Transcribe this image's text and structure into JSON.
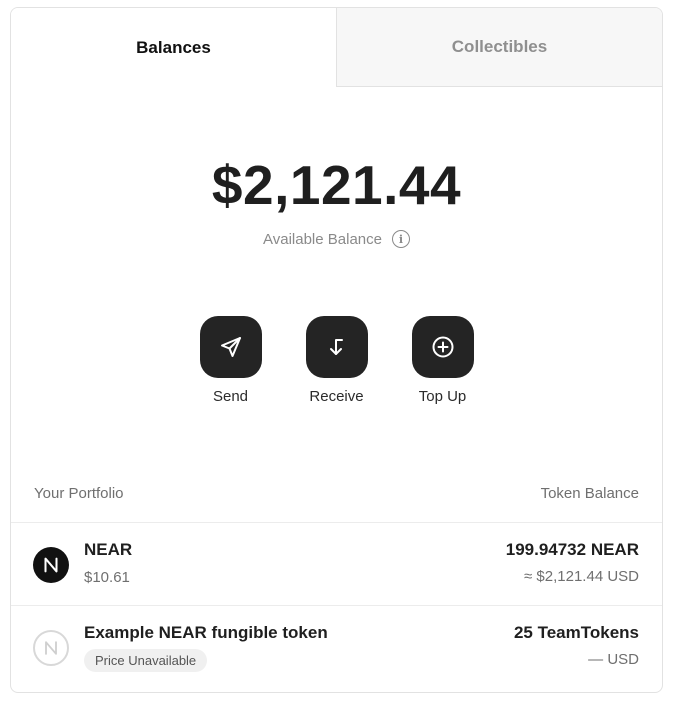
{
  "tabs": [
    {
      "label": "Balances",
      "active": true
    },
    {
      "label": "Collectibles",
      "active": false
    }
  ],
  "balance": {
    "amount": "$2,121.44",
    "label": "Available Balance",
    "info_icon": "info-icon"
  },
  "actions": [
    {
      "label": "Send",
      "icon": "send-icon"
    },
    {
      "label": "Receive",
      "icon": "receive-icon"
    },
    {
      "label": "Top Up",
      "icon": "plus-circle-icon"
    }
  ],
  "portfolio": {
    "left_header": "Your Portfolio",
    "right_header": "Token Balance",
    "tokens": [
      {
        "name": "NEAR",
        "price": "$10.61",
        "amount": "199.94732 NEAR",
        "usd": "≈ $2,121.44 USD",
        "logo": "near-logo-icon"
      },
      {
        "name": "Example NEAR fungible token",
        "price_badge": "Price Unavailable",
        "amount": "25 TeamTokens",
        "usd": "— USD",
        "logo": "near-logo-outline-icon"
      }
    ]
  },
  "colors": {
    "button_bg": "#242424",
    "inactive_tab_bg": "#f7f7f7",
    "muted_text": "#6f6f6f"
  }
}
